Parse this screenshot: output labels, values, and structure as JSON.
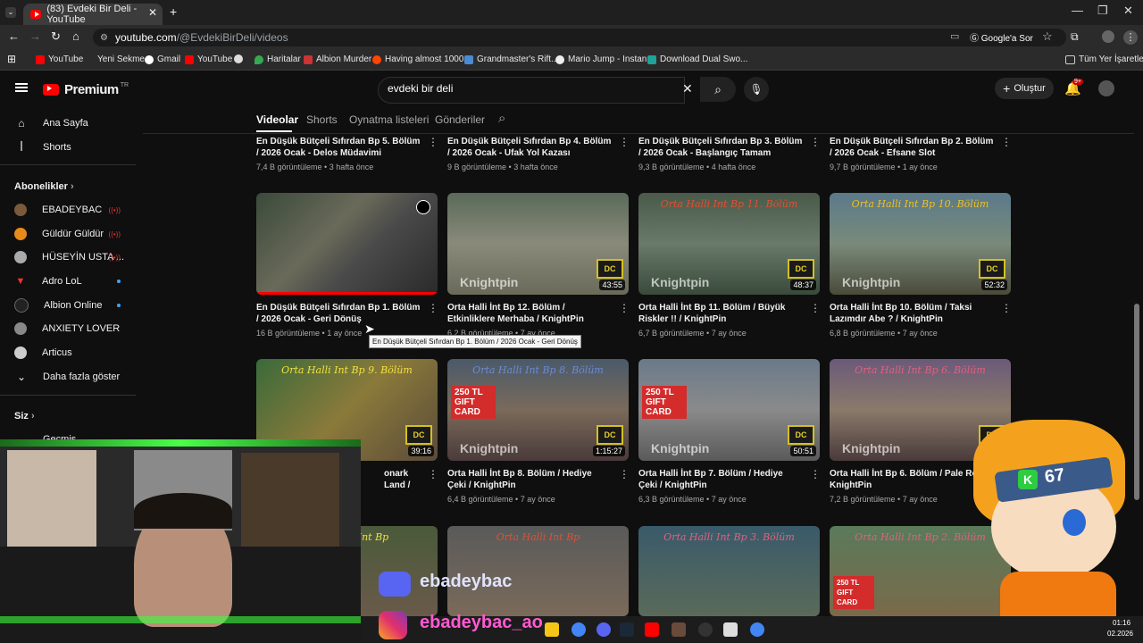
{
  "browser": {
    "tab_title": "(83) Evdeki Bir Deli - YouTube",
    "url_host": "youtube.com",
    "url_path": "/@EvdekiBirDeli/videos",
    "google_lens_label": "Google'a Sor",
    "bookmarks": [
      "YouTube",
      "Yeni Sekme",
      "Gmail",
      "YouTube",
      "Haritalar",
      "Albion Murder",
      "Having almost 1000...",
      "Grandmaster's Rift...",
      "Mario Jump - Instan...",
      "Download Dual Swo..."
    ],
    "all_bookmarks_label": "Tüm Yer İşaretleri"
  },
  "header": {
    "logo_text": "Premium",
    "logo_region": "TR",
    "search_value": "evdeki bir deli",
    "create_label": "Oluştur",
    "notif_badge": "9+"
  },
  "sidebar": {
    "items": [
      {
        "label": "Ana Sayfa",
        "icon": "home-icon"
      },
      {
        "label": "Shorts",
        "icon": "shorts-icon"
      }
    ],
    "subs_heading": "Abonelikler",
    "subscriptions": [
      {
        "label": "EBADEYBAC",
        "status": "live"
      },
      {
        "label": "Güldür Güldür",
        "status": "live"
      },
      {
        "label": "HÜSEYİN USTA ...",
        "status": "live"
      },
      {
        "label": "Adro LoL",
        "status": "new"
      },
      {
        "label": "Albion Online",
        "status": "new"
      },
      {
        "label": "ANXIETY LOVER",
        "status": ""
      },
      {
        "label": "Articus",
        "status": ""
      }
    ],
    "show_more": "Daha fazla göster",
    "you_heading": "Siz",
    "history_label": "Geçmiş"
  },
  "channel_tabs": [
    "Videolar",
    "Shorts",
    "Oynatma listeleri",
    "Gönderiler"
  ],
  "videos_row1": [
    {
      "title": "En Düşük Bütçeli Sıfırdan Bp 5. Bölüm / 2026 Ocak - Delos Müdavimi",
      "meta": "7,4 B görüntüleme • 3 hafta önce"
    },
    {
      "title": "En Düşük Bütçeli Sıfırdan Bp 4. Bölüm / 2026 Ocak - Ufak Yol Kazası",
      "meta": "9 B görüntüleme • 3 hafta önce"
    },
    {
      "title": "En Düşük Bütçeli Sıfırdan Bp 3. Bölüm / 2026 Ocak - Başlangıç Tamam",
      "meta": "9,3 B görüntüleme • 4 hafta önce"
    },
    {
      "title": "En Düşük Bütçeli Sıfırdan Bp 2. Bölüm / 2026 Ocak - Efsane Slot",
      "meta": "9,7 B görüntüleme • 1 ay önce"
    }
  ],
  "videos_row2": [
    {
      "title": "En Düşük Bütçeli Sıfırdan Bp 1. Bölüm / 2026 Ocak - Geri Dönüş",
      "meta": "16 B görüntüleme • 1 ay önce",
      "duration": "",
      "thumb_text": ""
    },
    {
      "title": "Orta Halli İnt Bp 12. Bölüm / Etkinliklere Merhaba / KnightPin",
      "meta": "6,2 B görüntüleme • 7 ay önce",
      "duration": "43:55",
      "thumb_text": ""
    },
    {
      "title": "Orta Halli İnt Bp 11. Bölüm / Büyük Riskler !! / KnightPin",
      "meta": "6,7 B görüntüleme • 7 ay önce",
      "duration": "48:37",
      "thumb_text": "Orta Halli Int Bp 11. Bölüm"
    },
    {
      "title": "Orta Halli İnt Bp 10. Bölüm / Taksi Lazımdır Abe ? / KnightPin",
      "meta": "6,8 B görüntüleme • 7 ay önce",
      "duration": "52:32",
      "thumb_text": "Orta Halli Int Bp 10. Bölüm"
    }
  ],
  "videos_row3": [
    {
      "title": "onark Land /",
      "meta": "",
      "duration": "39:16",
      "thumb_text": "Orta Halli Int Bp 9. Bölüm"
    },
    {
      "title": "Orta Halli İnt Bp 8. Bölüm / Hediye Çeki / KnightPin",
      "meta": "6,4 B görüntüleme • 7 ay önce",
      "duration": "1:15:27",
      "thumb_text": "Orta Halli Int Bp 8. Bölüm",
      "gift": "250 TL GIFT CARD"
    },
    {
      "title": "Orta Halli İnt Bp 7. Bölüm / Hediye Çeki / KnightPin",
      "meta": "6,3 B görüntüleme • 7 ay önce",
      "duration": "50:51",
      "thumb_text": "",
      "gift": "250 TL GIFT CARD"
    },
    {
      "title": "Orta Halli İnt Bp 6. Bölüm / Pale Rose / KnightPin",
      "meta": "7,2 B görüntüleme • 7 ay önce",
      "duration": "",
      "thumb_text": "Orta Halli Int Bp 6. Bölüm"
    }
  ],
  "videos_row4": [
    {
      "thumb_text": "Orta Halli Int Bp"
    },
    {
      "thumb_text": "Orta Halli Int Bp"
    },
    {
      "thumb_text": "Orta Halli Int Bp 3. Bölüm"
    },
    {
      "thumb_text": "Orta Halli Int Bp 2. Bölüm",
      "gift": "250 TL GIFT CARD"
    }
  ],
  "tooltip": "En Düşük Bütçeli Sıfırdan Bp 1. Bölüm / 2026 Ocak - Geri Dönüş",
  "overlay": {
    "discord_handle": "ebadeybac",
    "instagram_handle": "ebadeybac_ao",
    "badge_number": "67"
  },
  "taskbar": {
    "time": "01:16",
    "date": "02.2026"
  },
  "brand_watermark": "Knightpin",
  "dc_badge": "DC"
}
